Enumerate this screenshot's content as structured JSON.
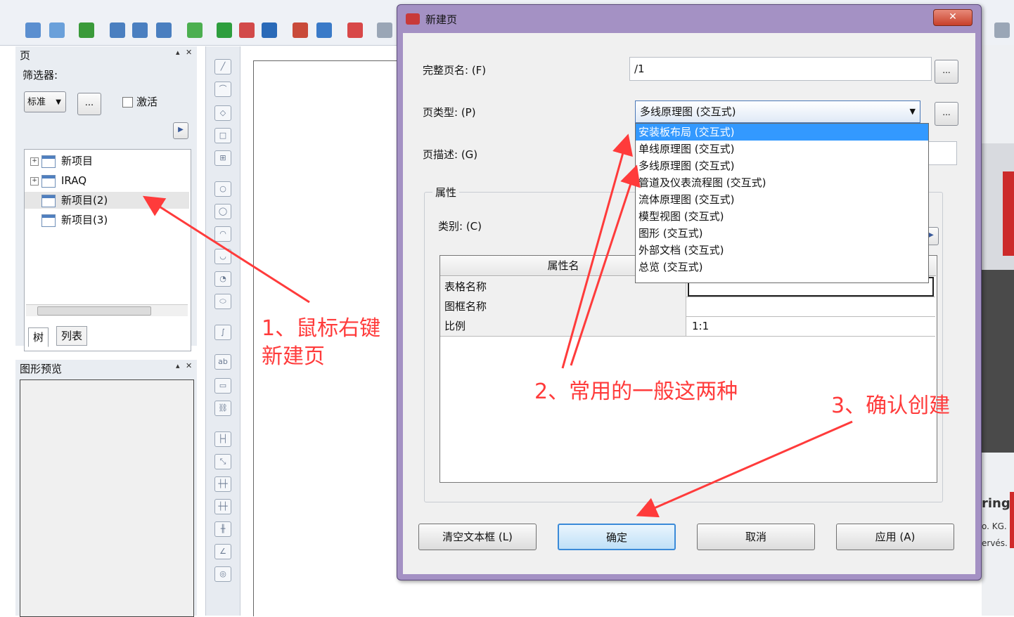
{
  "left_panel": {
    "title": "页",
    "filter_label": "筛选器:",
    "filter_value": "标准",
    "filter_more": "...",
    "activate_label": "激活",
    "tree_items": [
      {
        "label": "新项目",
        "expandable": true
      },
      {
        "label": "IRAQ",
        "expandable": true
      },
      {
        "label": "新项目(2)",
        "expandable": false,
        "selected": true
      },
      {
        "label": "新项目(3)",
        "expandable": false
      }
    ],
    "tabs": [
      "树",
      "列表"
    ]
  },
  "preview_panel": {
    "title": "图形预览"
  },
  "dialog": {
    "title": "新建页",
    "close": "✕",
    "full_name_label": "完整页名: (F)",
    "full_name_value": "/1",
    "page_type_label": "页类型: (P)",
    "page_type_value": "多线原理图 (交互式)",
    "page_desc_label": "页描述: (G)",
    "dropdown_options": [
      "安装板布局 (交互式)",
      "单线原理图 (交互式)",
      "多线原理图 (交互式)",
      "管道及仪表流程图 (交互式)",
      "流体原理图 (交互式)",
      "模型视图 (交互式)",
      "图形 (交互式)",
      "外部文档 (交互式)",
      "总览 (交互式)"
    ],
    "properties_group": "属性",
    "category_label": "类别: (C)",
    "grid_header": "属性名",
    "grid_rows": [
      {
        "name": "表格名称",
        "value": ""
      },
      {
        "name": "图框名称",
        "value": ""
      },
      {
        "name": "比例",
        "value": "1:1"
      }
    ],
    "buttons": {
      "clear": "清空文本框 (L)",
      "ok": "确定",
      "cancel": "取消",
      "apply": "应用 (A)"
    },
    "ellipsis": "..."
  },
  "annotations": {
    "step1_line1": "1、鼠标右键",
    "step1_line2": "新建页",
    "step2": "2、常用的一般这两种",
    "step3": "3、确认创建",
    "color": "#ff3b3b"
  },
  "background_fragments": [
    "ring",
    "o. KG.",
    "ervés."
  ]
}
